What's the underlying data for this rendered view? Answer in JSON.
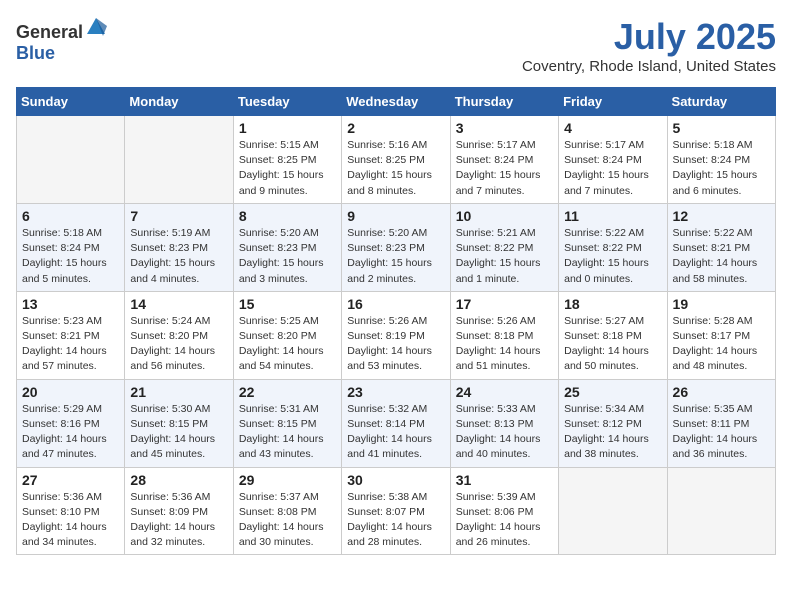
{
  "header": {
    "logo_general": "General",
    "logo_blue": "Blue",
    "title": "July 2025",
    "subtitle": "Coventry, Rhode Island, United States"
  },
  "weekdays": [
    "Sunday",
    "Monday",
    "Tuesday",
    "Wednesday",
    "Thursday",
    "Friday",
    "Saturday"
  ],
  "weeks": [
    [
      {
        "day": "",
        "detail": ""
      },
      {
        "day": "",
        "detail": ""
      },
      {
        "day": "1",
        "detail": "Sunrise: 5:15 AM\nSunset: 8:25 PM\nDaylight: 15 hours and 9 minutes."
      },
      {
        "day": "2",
        "detail": "Sunrise: 5:16 AM\nSunset: 8:25 PM\nDaylight: 15 hours and 8 minutes."
      },
      {
        "day": "3",
        "detail": "Sunrise: 5:17 AM\nSunset: 8:24 PM\nDaylight: 15 hours and 7 minutes."
      },
      {
        "day": "4",
        "detail": "Sunrise: 5:17 AM\nSunset: 8:24 PM\nDaylight: 15 hours and 7 minutes."
      },
      {
        "day": "5",
        "detail": "Sunrise: 5:18 AM\nSunset: 8:24 PM\nDaylight: 15 hours and 6 minutes."
      }
    ],
    [
      {
        "day": "6",
        "detail": "Sunrise: 5:18 AM\nSunset: 8:24 PM\nDaylight: 15 hours and 5 minutes."
      },
      {
        "day": "7",
        "detail": "Sunrise: 5:19 AM\nSunset: 8:23 PM\nDaylight: 15 hours and 4 minutes."
      },
      {
        "day": "8",
        "detail": "Sunrise: 5:20 AM\nSunset: 8:23 PM\nDaylight: 15 hours and 3 minutes."
      },
      {
        "day": "9",
        "detail": "Sunrise: 5:20 AM\nSunset: 8:23 PM\nDaylight: 15 hours and 2 minutes."
      },
      {
        "day": "10",
        "detail": "Sunrise: 5:21 AM\nSunset: 8:22 PM\nDaylight: 15 hours and 1 minute."
      },
      {
        "day": "11",
        "detail": "Sunrise: 5:22 AM\nSunset: 8:22 PM\nDaylight: 15 hours and 0 minutes."
      },
      {
        "day": "12",
        "detail": "Sunrise: 5:22 AM\nSunset: 8:21 PM\nDaylight: 14 hours and 58 minutes."
      }
    ],
    [
      {
        "day": "13",
        "detail": "Sunrise: 5:23 AM\nSunset: 8:21 PM\nDaylight: 14 hours and 57 minutes."
      },
      {
        "day": "14",
        "detail": "Sunrise: 5:24 AM\nSunset: 8:20 PM\nDaylight: 14 hours and 56 minutes."
      },
      {
        "day": "15",
        "detail": "Sunrise: 5:25 AM\nSunset: 8:20 PM\nDaylight: 14 hours and 54 minutes."
      },
      {
        "day": "16",
        "detail": "Sunrise: 5:26 AM\nSunset: 8:19 PM\nDaylight: 14 hours and 53 minutes."
      },
      {
        "day": "17",
        "detail": "Sunrise: 5:26 AM\nSunset: 8:18 PM\nDaylight: 14 hours and 51 minutes."
      },
      {
        "day": "18",
        "detail": "Sunrise: 5:27 AM\nSunset: 8:18 PM\nDaylight: 14 hours and 50 minutes."
      },
      {
        "day": "19",
        "detail": "Sunrise: 5:28 AM\nSunset: 8:17 PM\nDaylight: 14 hours and 48 minutes."
      }
    ],
    [
      {
        "day": "20",
        "detail": "Sunrise: 5:29 AM\nSunset: 8:16 PM\nDaylight: 14 hours and 47 minutes."
      },
      {
        "day": "21",
        "detail": "Sunrise: 5:30 AM\nSunset: 8:15 PM\nDaylight: 14 hours and 45 minutes."
      },
      {
        "day": "22",
        "detail": "Sunrise: 5:31 AM\nSunset: 8:15 PM\nDaylight: 14 hours and 43 minutes."
      },
      {
        "day": "23",
        "detail": "Sunrise: 5:32 AM\nSunset: 8:14 PM\nDaylight: 14 hours and 41 minutes."
      },
      {
        "day": "24",
        "detail": "Sunrise: 5:33 AM\nSunset: 8:13 PM\nDaylight: 14 hours and 40 minutes."
      },
      {
        "day": "25",
        "detail": "Sunrise: 5:34 AM\nSunset: 8:12 PM\nDaylight: 14 hours and 38 minutes."
      },
      {
        "day": "26",
        "detail": "Sunrise: 5:35 AM\nSunset: 8:11 PM\nDaylight: 14 hours and 36 minutes."
      }
    ],
    [
      {
        "day": "27",
        "detail": "Sunrise: 5:36 AM\nSunset: 8:10 PM\nDaylight: 14 hours and 34 minutes."
      },
      {
        "day": "28",
        "detail": "Sunrise: 5:36 AM\nSunset: 8:09 PM\nDaylight: 14 hours and 32 minutes."
      },
      {
        "day": "29",
        "detail": "Sunrise: 5:37 AM\nSunset: 8:08 PM\nDaylight: 14 hours and 30 minutes."
      },
      {
        "day": "30",
        "detail": "Sunrise: 5:38 AM\nSunset: 8:07 PM\nDaylight: 14 hours and 28 minutes."
      },
      {
        "day": "31",
        "detail": "Sunrise: 5:39 AM\nSunset: 8:06 PM\nDaylight: 14 hours and 26 minutes."
      },
      {
        "day": "",
        "detail": ""
      },
      {
        "day": "",
        "detail": ""
      }
    ]
  ]
}
